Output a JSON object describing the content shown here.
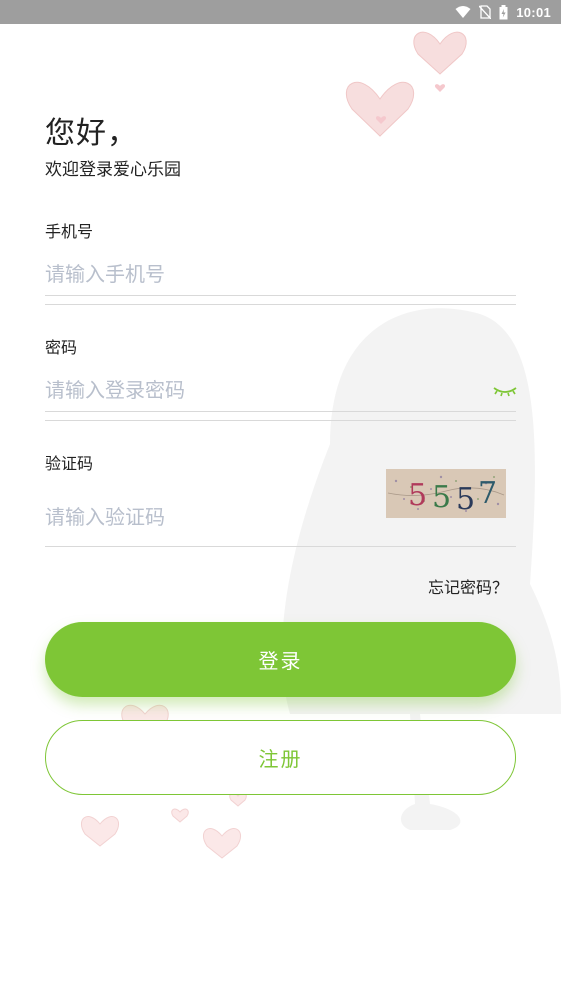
{
  "status_bar": {
    "time": "10:01",
    "icons": [
      "wifi-icon",
      "no-sim-icon",
      "battery-charging-icon"
    ]
  },
  "greeting": {
    "title": "您好，",
    "subtitle": "欢迎登录爱心乐园"
  },
  "form": {
    "phone": {
      "label": "手机号",
      "placeholder": "请输入手机号",
      "value": ""
    },
    "password": {
      "label": "密码",
      "placeholder": "请输入登录密码",
      "value": "",
      "toggle_icon": "eye-closed-icon"
    },
    "captcha": {
      "label": "验证码",
      "placeholder": "请输入验证码",
      "value": "",
      "image_text": "5557"
    },
    "forgot_label": "忘记密码？"
  },
  "buttons": {
    "login_label": "登录",
    "register_label": "注册"
  },
  "colors": {
    "accent": "#7ec636",
    "statusbar": "#9e9e9e",
    "placeholder": "#b8bfcc",
    "divider": "#d9d9d9"
  }
}
